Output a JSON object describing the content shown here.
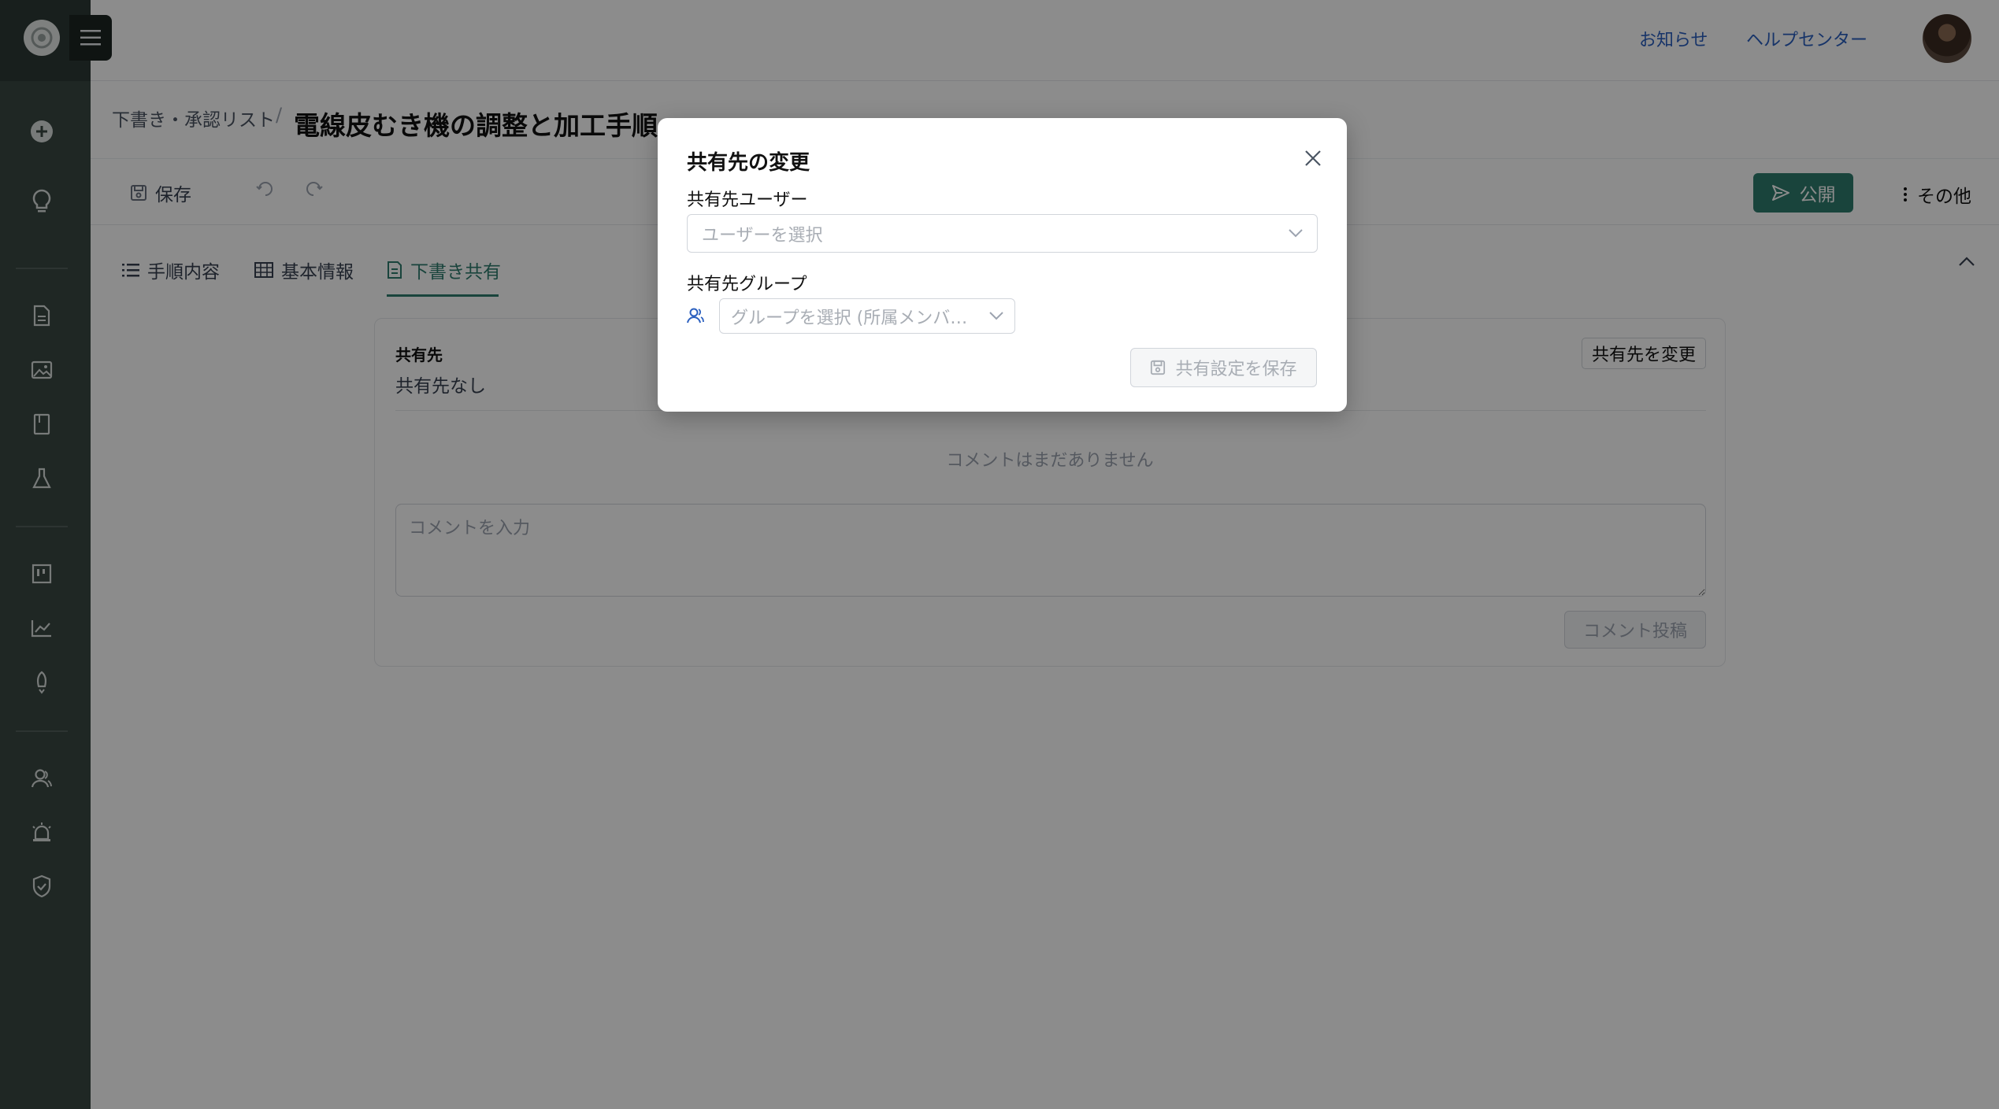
{
  "header": {
    "notice_link": "お知らせ",
    "help_link": "ヘルプセンター"
  },
  "titlebar": {
    "breadcrumb": "下書き・承認リスト",
    "separator": "/",
    "title": "電線皮むき機の調整と加工手順"
  },
  "toolbar": {
    "save_label": "保存",
    "publish_label": "公開",
    "more_label": "その他"
  },
  "tabs": [
    {
      "label": "手順内容",
      "icon": "list-icon"
    },
    {
      "label": "基本情報",
      "icon": "table-icon"
    },
    {
      "label": "下書き共有",
      "icon": "document-share-icon",
      "active": true
    }
  ],
  "share_card": {
    "share_label": "共有先",
    "share_value": "共有先なし",
    "change_button": "共有先を変更",
    "no_comments": "コメントはまだありません",
    "comment_placeholder": "コメントを入力",
    "post_button": "コメント投稿"
  },
  "modal": {
    "title": "共有先の変更",
    "user_label": "共有先ユーザー",
    "user_placeholder": "ユーザーを選択",
    "group_label": "共有先グループ",
    "group_placeholder": "グループを選択 (所属メンバ…",
    "save_button": "共有設定を保存"
  },
  "colors": {
    "sidebar": "#3a4743",
    "accent": "#2f7c6e",
    "link": "#2a5fbf"
  }
}
